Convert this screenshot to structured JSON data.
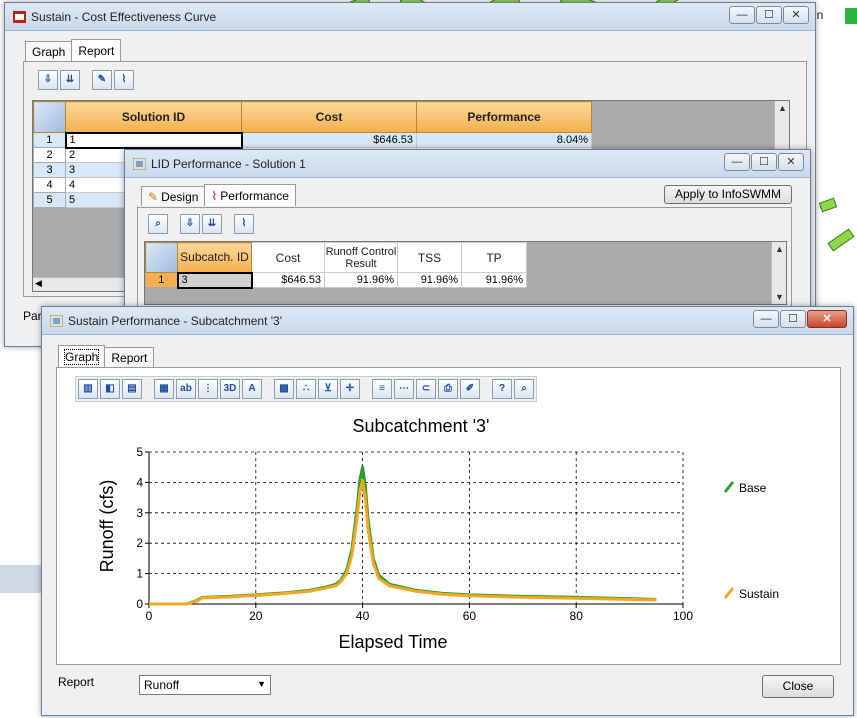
{
  "background_app": {
    "menu_fragment": "in",
    "colors": {
      "land": "#8fd64a"
    }
  },
  "cost_window": {
    "title": "Sustain - Cost Effectiveness Curve",
    "tabs": [
      {
        "label": "Graph"
      },
      {
        "label": "Report"
      }
    ],
    "toolbar": {
      "icons": [
        "export-icon",
        "sort-icon",
        "edit-icon",
        "chart-icon"
      ]
    },
    "table": {
      "headers": [
        "Solution ID",
        "Cost",
        "Performance"
      ],
      "rows": [
        {
          "num": "1",
          "id": "1",
          "cost": "$646.53",
          "perf": "8.04%"
        },
        {
          "num": "2",
          "id": "2",
          "cost": "",
          "perf": ""
        },
        {
          "num": "3",
          "id": "3",
          "cost": "",
          "perf": ""
        },
        {
          "num": "4",
          "id": "4",
          "cost": "",
          "perf": ""
        },
        {
          "num": "5",
          "id": "5",
          "cost": "",
          "perf": ""
        }
      ]
    },
    "footer_label": "Para"
  },
  "lid_window": {
    "title": "LID Performance - Solution 1",
    "tabs": [
      {
        "label": "Design"
      },
      {
        "label": "Performance"
      }
    ],
    "apply_button": "Apply to InfoSWMM",
    "table": {
      "headers": [
        "Subcatch. ID",
        "Cost",
        "Runoff Control Result",
        "TSS",
        "TP"
      ],
      "rows": [
        {
          "num": "1",
          "id": "3",
          "cost": "$646.53",
          "runoff": "91.96%",
          "tss": "91.96%",
          "tp": "91.96%"
        }
      ]
    }
  },
  "perf_window": {
    "title": "Sustain Performance - Subcatchment '3'",
    "tabs": [
      {
        "label": "Graph"
      },
      {
        "label": "Report"
      }
    ],
    "report_label": "Report",
    "report_select": "Runoff",
    "close_button": "Close"
  },
  "chart_data": {
    "type": "line",
    "title": "Subcatchment '3'",
    "xlabel": "Elapsed Time",
    "ylabel": "Runoff (cfs)",
    "xlim": [
      0,
      100
    ],
    "ylim": [
      0,
      5
    ],
    "xticks": [
      "0",
      "20",
      "40",
      "60",
      "80",
      "100"
    ],
    "yticks": [
      "0",
      "1",
      "2",
      "3",
      "4",
      "5"
    ],
    "grid": true,
    "legend": "right",
    "series": [
      {
        "name": "Base",
        "color": "#2aa02a",
        "x": [
          0,
          7,
          9,
          10,
          15,
          20,
          25,
          30,
          33,
          35,
          36,
          37,
          38,
          39,
          39.5,
          40,
          40.5,
          41,
          42,
          43,
          45,
          50,
          55,
          60,
          70,
          80,
          95
        ],
        "y": [
          0,
          0,
          0.12,
          0.22,
          0.25,
          0.3,
          0.36,
          0.45,
          0.55,
          0.65,
          0.8,
          1.1,
          1.8,
          3.2,
          4.1,
          4.5,
          3.9,
          2.8,
          1.5,
          0.95,
          0.65,
          0.45,
          0.35,
          0.3,
          0.25,
          0.22,
          0.15
        ]
      },
      {
        "name": "Sustain",
        "color": "#f5a623",
        "x": [
          0,
          7,
          9,
          10,
          15,
          20,
          25,
          30,
          33,
          35,
          36,
          37,
          38,
          39,
          39.5,
          40,
          40.5,
          41,
          42,
          43,
          45,
          50,
          55,
          60,
          70,
          80,
          95
        ],
        "y": [
          0,
          0,
          0.1,
          0.2,
          0.23,
          0.28,
          0.34,
          0.42,
          0.52,
          0.6,
          0.75,
          1.0,
          1.6,
          2.9,
          3.7,
          4.05,
          3.5,
          2.5,
          1.35,
          0.85,
          0.6,
          0.42,
          0.32,
          0.27,
          0.22,
          0.19,
          0.13
        ]
      }
    ]
  }
}
